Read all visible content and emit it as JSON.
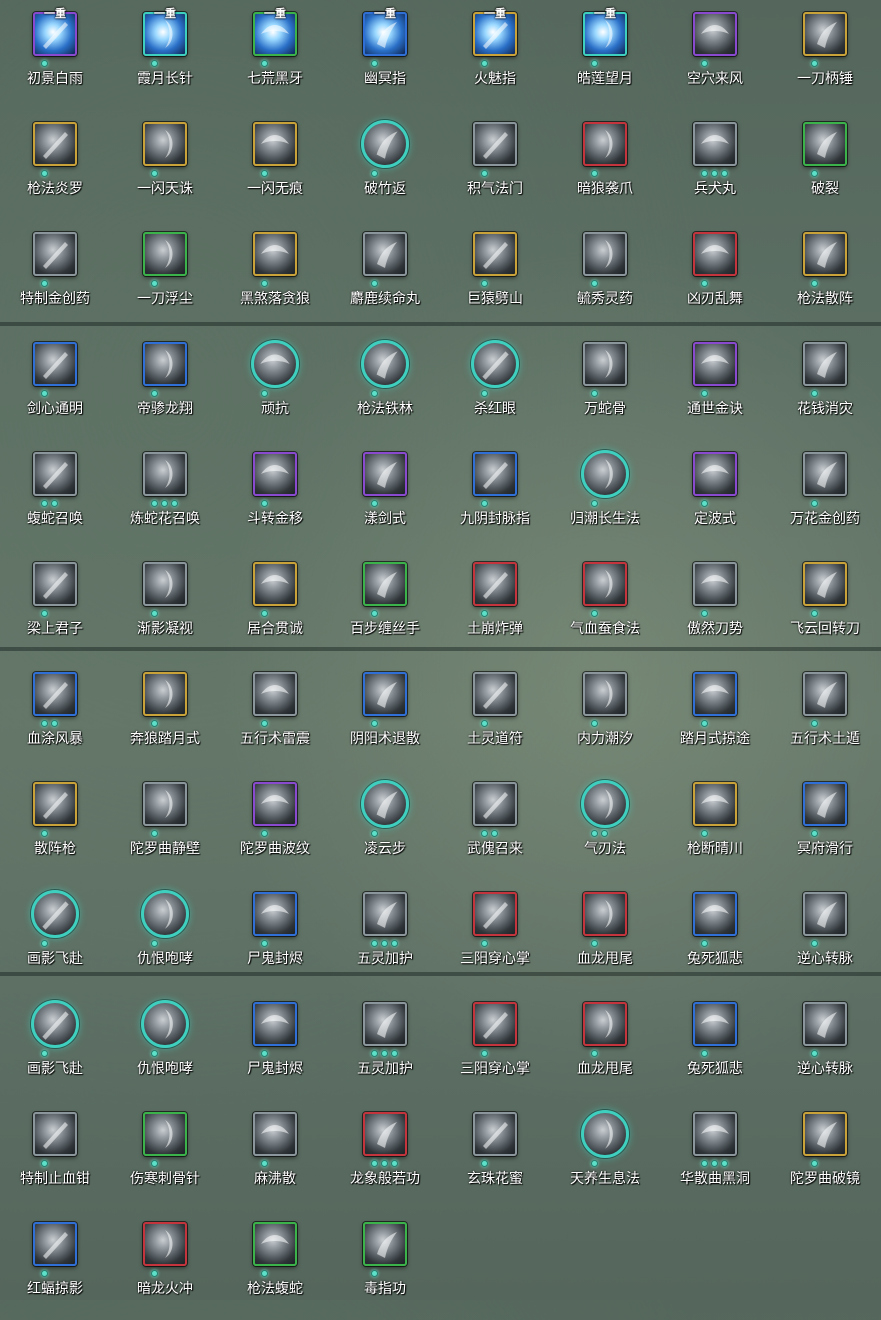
{
  "colors": {
    "blue": "#2f6fd6",
    "purple": "#8a4ad0",
    "gold": "#c9a23a",
    "green": "#3bb34a",
    "red": "#c4343c",
    "gray": "#8b959c",
    "teal": "#3fcfbf"
  },
  "badge_text": "一重",
  "skills": [
    {
      "name": "初景白雨",
      "frame": "purple",
      "badge": "一重",
      "dots": 1,
      "colored": true,
      "icon": "vortex-icon"
    },
    {
      "name": "霞月长针",
      "frame": "teal",
      "badge": "一重",
      "dots": 1,
      "colored": true,
      "icon": "needles-icon"
    },
    {
      "name": "七荒黑牙",
      "frame": "green",
      "badge": "一重",
      "dots": 1,
      "colored": true,
      "icon": "fang-icon"
    },
    {
      "name": "幽冥指",
      "frame": "blue",
      "badge": "一重",
      "dots": 1,
      "colored": true,
      "icon": "finger-icon"
    },
    {
      "name": "火魅指",
      "frame": "gold",
      "badge": "一重",
      "dots": 1,
      "colored": true,
      "icon": "fire-icon"
    },
    {
      "name": "皓莲望月",
      "frame": "teal",
      "badge": "一重",
      "dots": 1,
      "colored": true,
      "icon": "crescent-moon-icon"
    },
    {
      "name": "空穴来风",
      "frame": "purple",
      "dots": 1,
      "icon": "coin-hand-icon"
    },
    {
      "name": "一刀柄锤",
      "frame": "gold",
      "dots": 1,
      "icon": "blade-icon"
    },
    {
      "name": "枪法炎罗",
      "frame": "gold",
      "dots": 1,
      "icon": "spear-icon"
    },
    {
      "name": "一闪天诛",
      "frame": "gold",
      "dots": 1,
      "icon": "slash-icon"
    },
    {
      "name": "一闪无痕",
      "frame": "gold",
      "dots": 1,
      "icon": "slash-icon"
    },
    {
      "name": "破竹返",
      "frame": "circle",
      "dots": 1,
      "icon": "bamboo-icon"
    },
    {
      "name": "积气法门",
      "frame": "gray",
      "dots": 1,
      "icon": "qi-icon"
    },
    {
      "name": "暗狼袭爪",
      "frame": "red",
      "dots": 1,
      "icon": "claw-icon"
    },
    {
      "name": "兵犬丸",
      "frame": "gray",
      "dots": 3,
      "icon": "dog-icon"
    },
    {
      "name": "破裂",
      "frame": "green",
      "dots": 1,
      "icon": "burst-icon"
    },
    {
      "name": "特制金创药",
      "frame": "gray",
      "dots": 1,
      "icon": "potion-icon"
    },
    {
      "name": "一刀浮尘",
      "frame": "green",
      "dots": 1,
      "icon": "blade-icon"
    },
    {
      "name": "黑煞落贪狼",
      "frame": "gold",
      "dots": 1,
      "icon": "wolf-icon"
    },
    {
      "name": "麝鹿续命丸",
      "frame": "gray",
      "dots": 1,
      "icon": "pill-icon"
    },
    {
      "name": "巨猿劈山",
      "frame": "gold",
      "dots": 1,
      "icon": "ape-icon"
    },
    {
      "name": "毓秀灵药",
      "frame": "gray",
      "dots": 1,
      "icon": "gourd-icon"
    },
    {
      "name": "凶刃乱舞",
      "frame": "red",
      "dots": 1,
      "icon": "blades-icon"
    },
    {
      "name": "枪法散阵",
      "frame": "gold",
      "dots": 1,
      "icon": "spear-icon"
    },
    {
      "name": "剑心通明",
      "frame": "blue",
      "dots": 1,
      "icon": "sword-icon"
    },
    {
      "name": "帝骖龙翔",
      "frame": "blue",
      "dots": 1,
      "icon": "dragon-icon"
    },
    {
      "name": "顽抗",
      "frame": "circle",
      "dots": 1,
      "icon": "figure-icon"
    },
    {
      "name": "枪法铁林",
      "frame": "circle",
      "dots": 1,
      "icon": "spear-icon"
    },
    {
      "name": "杀红眼",
      "frame": "circle",
      "dots": 1,
      "icon": "warrior-icon"
    },
    {
      "name": "万蛇骨",
      "frame": "gray",
      "dots": 1,
      "icon": "snake-icon"
    },
    {
      "name": "通世金诀",
      "frame": "purple",
      "dots": 1,
      "icon": "dice-icon"
    },
    {
      "name": "花钱消灾",
      "frame": "gray",
      "dots": 1,
      "icon": "pouch-icon"
    },
    {
      "name": "蝮蛇召唤",
      "frame": "gray",
      "dots": 2,
      "icon": "snake-icon"
    },
    {
      "name": "炼蛇花召唤",
      "frame": "gray",
      "dots": 3,
      "icon": "snake-icon"
    },
    {
      "name": "斗转金移",
      "frame": "purple",
      "dots": 1,
      "icon": "swirl-icon"
    },
    {
      "name": "漾剑式",
      "frame": "purple",
      "dots": 1,
      "icon": "sword-icon"
    },
    {
      "name": "九阴封脉指",
      "frame": "blue",
      "dots": 1,
      "icon": "finger-icon"
    },
    {
      "name": "归潮长生法",
      "frame": "circle",
      "dots": 1,
      "icon": "wave-icon"
    },
    {
      "name": "定波式",
      "frame": "purple",
      "dots": 1,
      "icon": "wave-icon"
    },
    {
      "name": "万花金创药",
      "frame": "gray",
      "dots": 1,
      "icon": "potion-icon"
    },
    {
      "name": "梁上君子",
      "frame": "gray",
      "dots": 1,
      "icon": "thief-icon"
    },
    {
      "name": "渐影凝视",
      "frame": "gray",
      "dots": 1,
      "icon": "gaze-icon"
    },
    {
      "name": "居合贯诚",
      "frame": "gold",
      "dots": 1,
      "icon": "slash-icon"
    },
    {
      "name": "百步缠丝手",
      "frame": "green",
      "dots": 1,
      "icon": "hand-icon"
    },
    {
      "name": "土崩炸弹",
      "frame": "red",
      "dots": 1,
      "icon": "bomb-icon"
    },
    {
      "name": "气血蚕食法",
      "frame": "red",
      "dots": 1,
      "icon": "blood-icon"
    },
    {
      "name": "傲然刀势",
      "frame": "gray",
      "dots": 1,
      "icon": "blade-icon"
    },
    {
      "name": "飞云回转刀",
      "frame": "gold",
      "dots": 1,
      "icon": "spin-blade-icon"
    },
    {
      "name": "血涂风暴",
      "frame": "blue",
      "dots": 2,
      "icon": "storm-icon"
    },
    {
      "name": "奔狼踏月式",
      "frame": "gold",
      "dots": 1,
      "icon": "wolf-icon"
    },
    {
      "name": "五行术雷震",
      "frame": "gray",
      "dots": 1,
      "icon": "thunder-icon"
    },
    {
      "name": "阴阳术退散",
      "frame": "blue",
      "dots": 1,
      "icon": "yinyang-icon"
    },
    {
      "name": "土灵道符",
      "frame": "gray",
      "dots": 1,
      "icon": "talisman-icon"
    },
    {
      "name": "内力潮汐",
      "frame": "gray",
      "dots": 1,
      "icon": "tide-icon"
    },
    {
      "name": "踏月式掠途",
      "frame": "blue",
      "dots": 1,
      "icon": "moon-step-icon"
    },
    {
      "name": "五行术土遁",
      "frame": "gray",
      "dots": 1,
      "icon": "earth-icon"
    },
    {
      "name": "散阵枪",
      "frame": "gold",
      "dots": 1,
      "icon": "spear-icon"
    },
    {
      "name": "陀罗曲静壁",
      "frame": "gray",
      "dots": 1,
      "icon": "wall-icon"
    },
    {
      "name": "陀罗曲波纹",
      "frame": "purple",
      "dots": 1,
      "icon": "ripple-icon"
    },
    {
      "name": "凌云步",
      "frame": "circle",
      "dots": 1,
      "icon": "step-icon"
    },
    {
      "name": "武傀召来",
      "frame": "gray",
      "dots": 2,
      "icon": "puppet-icon"
    },
    {
      "name": "气刃法",
      "frame": "circle",
      "dots": 2,
      "icon": "qi-blade-icon"
    },
    {
      "name": "枪断晴川",
      "frame": "gold",
      "dots": 1,
      "icon": "spear-icon"
    },
    {
      "name": "冥府滑行",
      "frame": "blue",
      "dots": 1,
      "icon": "horse-icon"
    },
    {
      "name": "画影飞赴",
      "frame": "circle",
      "dots": 1,
      "icon": "dash-icon"
    },
    {
      "name": "仇恨咆哮",
      "frame": "circle",
      "dots": 1,
      "icon": "roar-icon"
    },
    {
      "name": "尸鬼封烬",
      "frame": "blue",
      "dots": 1,
      "icon": "orb-icon"
    },
    {
      "name": "五灵加护",
      "frame": "gray",
      "dots": 3,
      "icon": "shrine-icon"
    },
    {
      "name": "三阳穿心掌",
      "frame": "red",
      "dots": 1,
      "icon": "palm-icon"
    },
    {
      "name": "血龙甩尾",
      "frame": "red",
      "dots": 1,
      "icon": "tail-icon"
    },
    {
      "name": "兔死狐悲",
      "frame": "blue",
      "dots": 1,
      "icon": "fox-icon"
    },
    {
      "name": "逆心转脉",
      "frame": "gray",
      "dots": 1,
      "icon": "pulse-icon"
    },
    {
      "name": "画影飞赴",
      "frame": "circle",
      "dots": 1,
      "icon": "dash-icon"
    },
    {
      "name": "仇恨咆哮",
      "frame": "circle",
      "dots": 1,
      "icon": "roar-icon"
    },
    {
      "name": "尸鬼封烬",
      "frame": "blue",
      "dots": 1,
      "icon": "orb-icon"
    },
    {
      "name": "五灵加护",
      "frame": "gray",
      "dots": 3,
      "icon": "shrine-icon"
    },
    {
      "name": "三阳穿心掌",
      "frame": "red",
      "dots": 1,
      "icon": "palm-icon"
    },
    {
      "name": "血龙甩尾",
      "frame": "red",
      "dots": 1,
      "icon": "tail-icon"
    },
    {
      "name": "兔死狐悲",
      "frame": "blue",
      "dots": 1,
      "icon": "fox-icon"
    },
    {
      "name": "逆心转脉",
      "frame": "gray",
      "dots": 1,
      "icon": "pulse-icon"
    },
    {
      "name": "特制止血钳",
      "frame": "gray",
      "dots": 1,
      "icon": "clamp-icon"
    },
    {
      "name": "伤寒刺骨针",
      "frame": "green",
      "dots": 1,
      "icon": "needle-icon"
    },
    {
      "name": "麻沸散",
      "frame": "gray",
      "dots": 1,
      "icon": "powder-icon"
    },
    {
      "name": "龙象般若功",
      "frame": "red",
      "dots": 3,
      "icon": "elephant-icon"
    },
    {
      "name": "玄珠花蜜",
      "frame": "gray",
      "dots": 1,
      "icon": "flower-icon"
    },
    {
      "name": "天养生息法",
      "frame": "circle",
      "dots": 1,
      "icon": "meditate-icon"
    },
    {
      "name": "华散曲黑洞",
      "frame": "gray",
      "dots": 3,
      "icon": "black-hole-icon"
    },
    {
      "name": "陀罗曲破镜",
      "frame": "gold",
      "dots": 1,
      "icon": "mirror-icon"
    },
    {
      "name": "红蝠掠影",
      "frame": "blue",
      "dots": 1,
      "icon": "bat-icon"
    },
    {
      "name": "暗龙火冲",
      "frame": "red",
      "dots": 1,
      "icon": "flame-dragon-icon"
    },
    {
      "name": "枪法蝮蛇",
      "frame": "green",
      "dots": 1,
      "icon": "spear-icon"
    },
    {
      "name": "毒指功",
      "frame": "green",
      "dots": 1,
      "icon": "poison-finger-icon"
    }
  ]
}
